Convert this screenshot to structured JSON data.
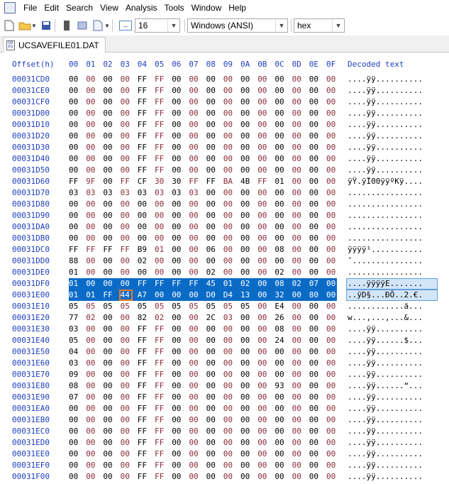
{
  "menu": [
    "File",
    "Edit",
    "Search",
    "View",
    "Analysis",
    "Tools",
    "Window",
    "Help"
  ],
  "toolbar": {
    "bytes_per_row": "16",
    "encoding": "Windows (ANSI)",
    "mode": "hex"
  },
  "tab": {
    "filename": "UCSAVEFILE01.DAT"
  },
  "hex": {
    "offset_header": "Offset(h)",
    "column_headers": [
      "00",
      "01",
      "02",
      "03",
      "04",
      "05",
      "06",
      "07",
      "08",
      "09",
      "0A",
      "0B",
      "0C",
      "0D",
      "0E",
      "0F"
    ],
    "decoded_header": "Decoded text",
    "selection_rows": [
      18,
      19
    ],
    "cursor": {
      "row": 19,
      "col": 3
    },
    "rows": [
      {
        "offset": "00031CD0",
        "bytes": [
          "00",
          "00",
          "00",
          "00",
          "FF",
          "FF",
          "00",
          "00",
          "00",
          "00",
          "00",
          "00",
          "00",
          "00",
          "00",
          "00"
        ],
        "text": "....ÿÿ.........."
      },
      {
        "offset": "00031CE0",
        "bytes": [
          "00",
          "00",
          "00",
          "00",
          "FF",
          "FF",
          "00",
          "00",
          "00",
          "00",
          "00",
          "00",
          "00",
          "00",
          "00",
          "00"
        ],
        "text": "....ÿÿ.........."
      },
      {
        "offset": "00031CF0",
        "bytes": [
          "00",
          "00",
          "00",
          "00",
          "FF",
          "FF",
          "00",
          "00",
          "00",
          "00",
          "00",
          "00",
          "00",
          "00",
          "00",
          "00"
        ],
        "text": "....ÿÿ.........."
      },
      {
        "offset": "00031D00",
        "bytes": [
          "00",
          "00",
          "00",
          "00",
          "FF",
          "FF",
          "00",
          "00",
          "00",
          "00",
          "00",
          "00",
          "00",
          "00",
          "00",
          "00"
        ],
        "text": "....ÿÿ.........."
      },
      {
        "offset": "00031D10",
        "bytes": [
          "00",
          "00",
          "00",
          "00",
          "FF",
          "FF",
          "00",
          "00",
          "00",
          "00",
          "00",
          "00",
          "00",
          "00",
          "00",
          "00"
        ],
        "text": "....ÿÿ.........."
      },
      {
        "offset": "00031D20",
        "bytes": [
          "00",
          "00",
          "00",
          "00",
          "FF",
          "FF",
          "00",
          "00",
          "00",
          "00",
          "00",
          "00",
          "00",
          "00",
          "00",
          "00"
        ],
        "text": "....ÿÿ.........."
      },
      {
        "offset": "00031D30",
        "bytes": [
          "00",
          "00",
          "00",
          "00",
          "FF",
          "FF",
          "00",
          "00",
          "00",
          "00",
          "00",
          "00",
          "00",
          "00",
          "00",
          "00"
        ],
        "text": "....ÿÿ.........."
      },
      {
        "offset": "00031D40",
        "bytes": [
          "00",
          "00",
          "00",
          "00",
          "FF",
          "FF",
          "00",
          "00",
          "00",
          "00",
          "00",
          "00",
          "00",
          "00",
          "00",
          "00"
        ],
        "text": "....ÿÿ.........."
      },
      {
        "offset": "00031D50",
        "bytes": [
          "00",
          "00",
          "00",
          "00",
          "FF",
          "FF",
          "00",
          "00",
          "00",
          "00",
          "00",
          "00",
          "00",
          "00",
          "00",
          "00"
        ],
        "text": "....ÿÿ.........."
      },
      {
        "offset": "00031D60",
        "bytes": [
          "FF",
          "9F",
          "00",
          "FF",
          "CF",
          "30",
          "30",
          "FF",
          "FF",
          "BA",
          "4B",
          "FF",
          "01",
          "00",
          "00",
          "00"
        ],
        "text": "ÿŸ.ÿÏ00ÿÿºKÿ...."
      },
      {
        "offset": "00031D70",
        "bytes": [
          "03",
          "03",
          "03",
          "03",
          "03",
          "03",
          "03",
          "03",
          "00",
          "00",
          "00",
          "00",
          "00",
          "00",
          "00",
          "00"
        ],
        "text": "................"
      },
      {
        "offset": "00031D80",
        "bytes": [
          "00",
          "00",
          "00",
          "00",
          "00",
          "00",
          "00",
          "00",
          "00",
          "00",
          "00",
          "00",
          "00",
          "00",
          "00",
          "00"
        ],
        "text": "................"
      },
      {
        "offset": "00031D90",
        "bytes": [
          "00",
          "00",
          "00",
          "00",
          "00",
          "00",
          "00",
          "00",
          "00",
          "00",
          "00",
          "00",
          "00",
          "00",
          "00",
          "00"
        ],
        "text": "................"
      },
      {
        "offset": "00031DA0",
        "bytes": [
          "00",
          "00",
          "00",
          "00",
          "00",
          "00",
          "00",
          "00",
          "00",
          "00",
          "00",
          "00",
          "00",
          "00",
          "00",
          "00"
        ],
        "text": "................"
      },
      {
        "offset": "00031DB0",
        "bytes": [
          "00",
          "00",
          "00",
          "00",
          "00",
          "00",
          "00",
          "00",
          "00",
          "00",
          "00",
          "00",
          "00",
          "00",
          "00",
          "00"
        ],
        "text": "................"
      },
      {
        "offset": "00031DC0",
        "bytes": [
          "FF",
          "FF",
          "FF",
          "FF",
          "B9",
          "01",
          "00",
          "00",
          "06",
          "00",
          "00",
          "00",
          "08",
          "00",
          "00",
          "00"
        ],
        "text": "ÿÿÿÿ¹..........."
      },
      {
        "offset": "00031DD0",
        "bytes": [
          "88",
          "00",
          "00",
          "00",
          "02",
          "00",
          "00",
          "00",
          "00",
          "00",
          "00",
          "00",
          "00",
          "00",
          "00",
          "00"
        ],
        "text": "ˆ..............."
      },
      {
        "offset": "00031DE0",
        "bytes": [
          "01",
          "00",
          "00",
          "00",
          "00",
          "00",
          "00",
          "00",
          "02",
          "00",
          "00",
          "00",
          "02",
          "00",
          "00",
          "00"
        ],
        "text": "................"
      },
      {
        "offset": "00031DF0",
        "bytes": [
          "01",
          "00",
          "00",
          "00",
          "FF",
          "FF",
          "FF",
          "FF",
          "45",
          "01",
          "02",
          "00",
          "08",
          "02",
          "07",
          "00"
        ],
        "text": "....ÿÿÿÿE......."
      },
      {
        "offset": "00031E00",
        "bytes": [
          "01",
          "01",
          "FF",
          "44",
          "A7",
          "00",
          "00",
          "00",
          "D0",
          "D4",
          "13",
          "00",
          "32",
          "00",
          "80",
          "00"
        ],
        "text": "..ÿD§...ÐÔ..2.€."
      },
      {
        "offset": "00031E10",
        "bytes": [
          "05",
          "05",
          "05",
          "05",
          "05",
          "05",
          "05",
          "05",
          "05",
          "05",
          "05",
          "00",
          "E4",
          "00",
          "00",
          "00"
        ],
        "text": "............ä..."
      },
      {
        "offset": "00031E20",
        "bytes": [
          "77",
          "02",
          "00",
          "00",
          "82",
          "02",
          "00",
          "00",
          "2C",
          "03",
          "00",
          "00",
          "26",
          "00",
          "00",
          "00"
        ],
        "text": "w...‚...,...&..."
      },
      {
        "offset": "00031E30",
        "bytes": [
          "03",
          "00",
          "00",
          "00",
          "FF",
          "FF",
          "00",
          "00",
          "00",
          "00",
          "00",
          "00",
          "08",
          "00",
          "00",
          "00"
        ],
        "text": "....ÿÿ.........."
      },
      {
        "offset": "00031E40",
        "bytes": [
          "05",
          "00",
          "00",
          "00",
          "FF",
          "FF",
          "00",
          "00",
          "00",
          "00",
          "00",
          "00",
          "24",
          "00",
          "00",
          "00"
        ],
        "text": "....ÿÿ......$..."
      },
      {
        "offset": "00031E50",
        "bytes": [
          "04",
          "00",
          "00",
          "00",
          "FF",
          "FF",
          "00",
          "00",
          "00",
          "00",
          "00",
          "00",
          "00",
          "00",
          "00",
          "00"
        ],
        "text": "....ÿÿ.........."
      },
      {
        "offset": "00031E60",
        "bytes": [
          "03",
          "00",
          "00",
          "00",
          "FF",
          "FF",
          "00",
          "00",
          "00",
          "00",
          "00",
          "00",
          "00",
          "00",
          "00",
          "00"
        ],
        "text": "....ÿÿ.........."
      },
      {
        "offset": "00031E70",
        "bytes": [
          "09",
          "00",
          "00",
          "00",
          "FF",
          "FF",
          "00",
          "00",
          "00",
          "00",
          "00",
          "00",
          "00",
          "00",
          "00",
          "00"
        ],
        "text": "....ÿÿ.........."
      },
      {
        "offset": "00031E80",
        "bytes": [
          "08",
          "00",
          "00",
          "00",
          "FF",
          "FF",
          "00",
          "00",
          "00",
          "00",
          "00",
          "00",
          "93",
          "00",
          "00",
          "00"
        ],
        "text": "....ÿÿ......“..."
      },
      {
        "offset": "00031E90",
        "bytes": [
          "07",
          "00",
          "00",
          "00",
          "FF",
          "FF",
          "00",
          "00",
          "00",
          "00",
          "00",
          "00",
          "00",
          "00",
          "00",
          "00"
        ],
        "text": "....ÿÿ.........."
      },
      {
        "offset": "00031EA0",
        "bytes": [
          "00",
          "00",
          "00",
          "00",
          "FF",
          "FF",
          "00",
          "00",
          "00",
          "00",
          "00",
          "00",
          "00",
          "00",
          "00",
          "00"
        ],
        "text": "....ÿÿ.........."
      },
      {
        "offset": "00031EB0",
        "bytes": [
          "00",
          "00",
          "00",
          "00",
          "FF",
          "FF",
          "00",
          "00",
          "00",
          "00",
          "00",
          "00",
          "00",
          "00",
          "00",
          "00"
        ],
        "text": "....ÿÿ.........."
      },
      {
        "offset": "00031EC0",
        "bytes": [
          "00",
          "00",
          "00",
          "00",
          "FF",
          "FF",
          "00",
          "00",
          "00",
          "00",
          "00",
          "00",
          "00",
          "00",
          "00",
          "00"
        ],
        "text": "....ÿÿ.........."
      },
      {
        "offset": "00031ED0",
        "bytes": [
          "00",
          "00",
          "00",
          "00",
          "FF",
          "FF",
          "00",
          "00",
          "00",
          "00",
          "00",
          "00",
          "00",
          "00",
          "00",
          "00"
        ],
        "text": "....ÿÿ.........."
      },
      {
        "offset": "00031EE0",
        "bytes": [
          "00",
          "00",
          "00",
          "00",
          "FF",
          "FF",
          "00",
          "00",
          "00",
          "00",
          "00",
          "00",
          "00",
          "00",
          "00",
          "00"
        ],
        "text": "....ÿÿ.........."
      },
      {
        "offset": "00031EF0",
        "bytes": [
          "00",
          "00",
          "00",
          "00",
          "FF",
          "FF",
          "00",
          "00",
          "00",
          "00",
          "00",
          "00",
          "00",
          "00",
          "00",
          "00"
        ],
        "text": "....ÿÿ.........."
      },
      {
        "offset": "00031F00",
        "bytes": [
          "00",
          "00",
          "00",
          "00",
          "FF",
          "FF",
          "00",
          "00",
          "00",
          "00",
          "00",
          "00",
          "00",
          "00",
          "00",
          "00"
        ],
        "text": "....ÿÿ.........."
      }
    ]
  },
  "colors": {
    "offset_blue": "#1f3fbf",
    "even_col": "#000000",
    "odd_col": "#8a2a3a",
    "selection": "#0a6bc7",
    "cursor": "#f07b1f"
  }
}
